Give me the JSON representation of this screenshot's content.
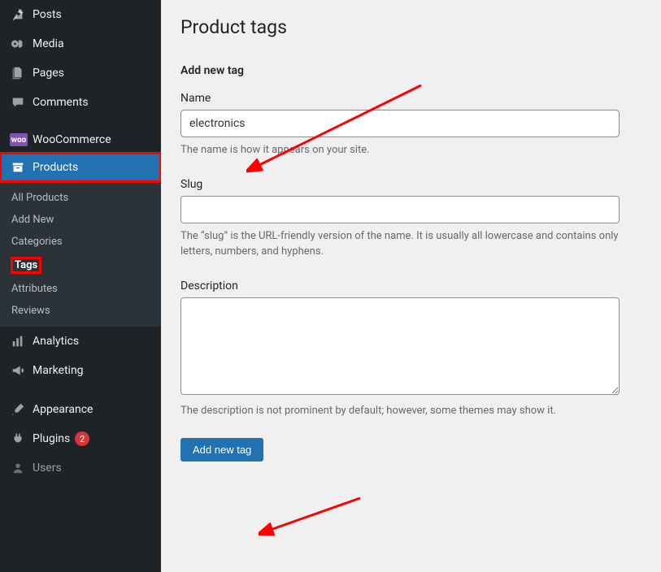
{
  "page": {
    "title": "Product tags",
    "section_title": "Add new tag",
    "name_label": "Name",
    "name_value": "electronics",
    "name_help": "The name is how it appears on your site.",
    "slug_label": "Slug",
    "slug_value": "",
    "slug_help": "The “slug” is the URL-friendly version of the name. It is usually all lowercase and contains only letters, numbers, and hyphens.",
    "desc_label": "Description",
    "desc_value": "",
    "desc_help": "The description is not prominent by default; however, some themes may show it.",
    "submit_label": "Add new tag"
  },
  "sidebar": {
    "posts": "Posts",
    "media": "Media",
    "pages": "Pages",
    "comments": "Comments",
    "woocommerce": "WooCommerce",
    "products": "Products",
    "analytics": "Analytics",
    "marketing": "Marketing",
    "appearance": "Appearance",
    "plugins": "Plugins",
    "plugins_count": "2",
    "users": "Users",
    "submenu": {
      "all_products": "All Products",
      "add_new": "Add New",
      "categories": "Categories",
      "tags": "Tags",
      "attributes": "Attributes",
      "reviews": "Reviews"
    }
  }
}
